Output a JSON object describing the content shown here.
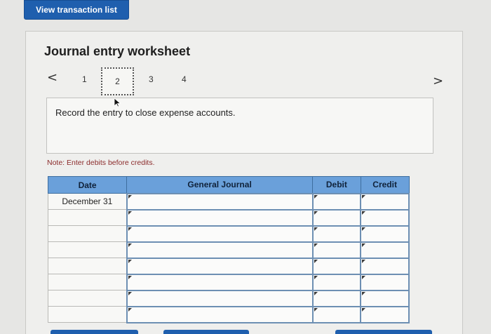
{
  "top_button": {
    "label": "View transaction list"
  },
  "worksheet": {
    "title": "Journal entry worksheet",
    "steps": [
      "1",
      "2",
      "3",
      "4"
    ],
    "active_step": "2",
    "prev_icon": "<",
    "next_icon": ">",
    "instruction": "Record the entry to close expense accounts.",
    "note": "Note: Enter debits before credits."
  },
  "table": {
    "headers": {
      "date": "Date",
      "journal": "General Journal",
      "debit": "Debit",
      "credit": "Credit"
    },
    "rows": [
      {
        "date": "December 31",
        "account": "",
        "debit": "",
        "credit": ""
      },
      {
        "date": "",
        "account": "",
        "debit": "",
        "credit": ""
      },
      {
        "date": "",
        "account": "",
        "debit": "",
        "credit": ""
      },
      {
        "date": "",
        "account": "",
        "debit": "",
        "credit": ""
      },
      {
        "date": "",
        "account": "",
        "debit": "",
        "credit": ""
      },
      {
        "date": "",
        "account": "",
        "debit": "",
        "credit": ""
      },
      {
        "date": "",
        "account": "",
        "debit": "",
        "credit": ""
      },
      {
        "date": "",
        "account": "",
        "debit": "",
        "credit": ""
      }
    ]
  },
  "colors": {
    "primary": "#1f5fae",
    "header": "#6aa0da",
    "note": "#8b2b2b"
  }
}
